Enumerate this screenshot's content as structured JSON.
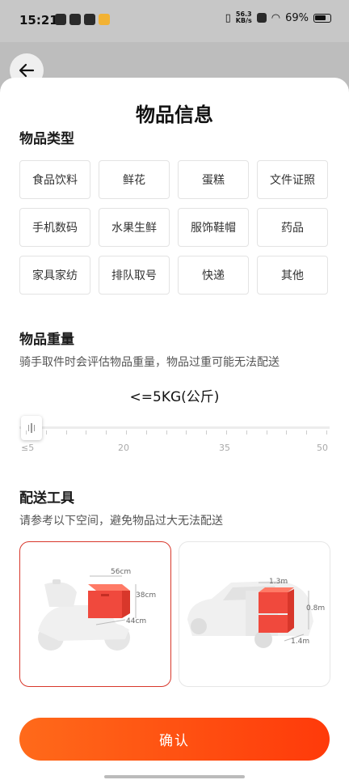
{
  "status_bar": {
    "time": "15:21",
    "net_speed_value": "56.3",
    "net_speed_unit": "KB/s",
    "battery": "69%"
  },
  "sheet": {
    "title": "物品信息"
  },
  "category": {
    "title": "物品类型",
    "items": [
      "食品饮料",
      "鲜花",
      "蛋糕",
      "文件证照",
      "手机数码",
      "水果生鲜",
      "服饰鞋帽",
      "药品",
      "家具家纺",
      "排队取号",
      "快递",
      "其他"
    ]
  },
  "weight": {
    "title": "物品重量",
    "subtitle": "骑手取件时会评估物品重量，物品过重可能无法配送",
    "value_label": "<=5KG(公斤)",
    "scale_labels": [
      "≤5",
      "20",
      "35",
      "50"
    ],
    "slider_fraction": 0
  },
  "tool": {
    "title": "配送工具",
    "subtitle": "请参考以下空间，避免物品过大无法配送",
    "scooter": {
      "w": "56cm",
      "h": "38cm",
      "d": "44cm"
    },
    "car": {
      "w": "1.3m",
      "h": "0.8m",
      "d": "1.4m"
    }
  },
  "confirm_label": "确认",
  "colors": {
    "accent": "#ff4a10",
    "selected_border": "#d8372b",
    "box": "#f0493d"
  }
}
